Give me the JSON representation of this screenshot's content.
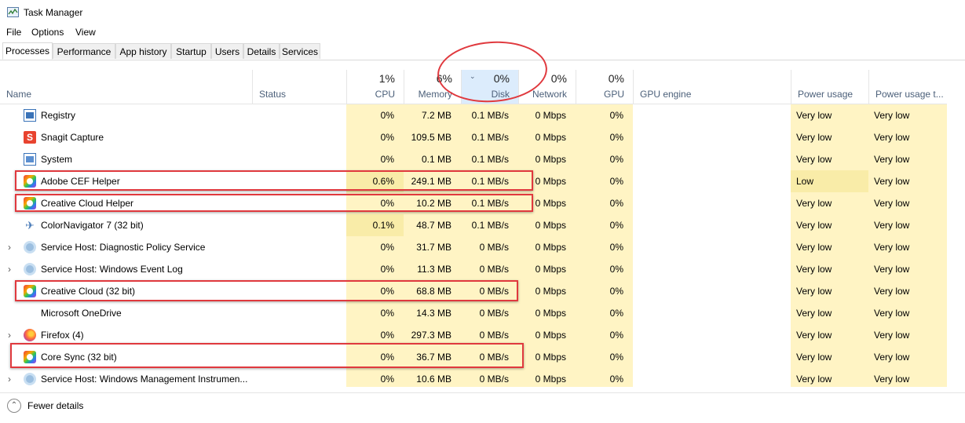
{
  "window": {
    "title": "Task Manager"
  },
  "menu": [
    "File",
    "Options",
    "View"
  ],
  "tabs": [
    "Processes",
    "Performance",
    "App history",
    "Startup",
    "Users",
    "Details",
    "Services"
  ],
  "active_tab": "Processes",
  "columns": {
    "name": "Name",
    "status": "Status",
    "cpu": {
      "pct": "1%",
      "label": "CPU"
    },
    "memory": {
      "pct": "6%",
      "label": "Memory"
    },
    "disk": {
      "pct": "0%",
      "label": "Disk"
    },
    "network": {
      "pct": "0%",
      "label": "Network"
    },
    "gpu": {
      "pct": "0%",
      "label": "GPU"
    },
    "gpu_engine": "GPU engine",
    "power": "Power usage",
    "power_trend": "Power usage t..."
  },
  "rows": [
    {
      "name": "Registry",
      "icon": "registry-icon",
      "expand": false,
      "cpu": "0%",
      "memory": "7.2 MB",
      "disk": "0.1 MB/s",
      "network": "0 Mbps",
      "gpu": "0%",
      "power": "Very low",
      "power_trend": "Very low"
    },
    {
      "name": "Snagit Capture",
      "icon": "snagit-icon",
      "expand": false,
      "cpu": "0%",
      "memory": "109.5 MB",
      "disk": "0.1 MB/s",
      "network": "0 Mbps",
      "gpu": "0%",
      "power": "Very low",
      "power_trend": "Very low"
    },
    {
      "name": "System",
      "icon": "system-icon",
      "expand": false,
      "cpu": "0%",
      "memory": "0.1 MB",
      "disk": "0.1 MB/s",
      "network": "0 Mbps",
      "gpu": "0%",
      "power": "Very low",
      "power_trend": "Very low"
    },
    {
      "name": "Adobe CEF Helper",
      "icon": "creative-cloud-icon",
      "expand": false,
      "cpu": "0.6%",
      "memory": "249.1 MB",
      "disk": "0.1 MB/s",
      "network": "0 Mbps",
      "gpu": "0%",
      "power": "Low",
      "power_trend": "Very low"
    },
    {
      "name": "Creative Cloud Helper",
      "icon": "creative-cloud-icon",
      "expand": false,
      "cpu": "0%",
      "memory": "10.2 MB",
      "disk": "0.1 MB/s",
      "network": "0 Mbps",
      "gpu": "0%",
      "power": "Very low",
      "power_trend": "Very low"
    },
    {
      "name": "ColorNavigator 7 (32 bit)",
      "icon": "colornavigator-icon",
      "expand": false,
      "cpu": "0.1%",
      "memory": "48.7 MB",
      "disk": "0.1 MB/s",
      "network": "0 Mbps",
      "gpu": "0%",
      "power": "Very low",
      "power_trend": "Very low"
    },
    {
      "name": "Service Host: Diagnostic Policy Service",
      "icon": "service-gear-icon",
      "expand": true,
      "cpu": "0%",
      "memory": "31.7 MB",
      "disk": "0 MB/s",
      "network": "0 Mbps",
      "gpu": "0%",
      "power": "Very low",
      "power_trend": "Very low"
    },
    {
      "name": "Service Host: Windows Event Log",
      "icon": "service-gear-icon",
      "expand": true,
      "cpu": "0%",
      "memory": "11.3 MB",
      "disk": "0 MB/s",
      "network": "0 Mbps",
      "gpu": "0%",
      "power": "Very low",
      "power_trend": "Very low"
    },
    {
      "name": "Creative Cloud (32 bit)",
      "icon": "creative-cloud-icon",
      "expand": false,
      "cpu": "0%",
      "memory": "68.8 MB",
      "disk": "0 MB/s",
      "network": "0 Mbps",
      "gpu": "0%",
      "power": "Very low",
      "power_trend": "Very low"
    },
    {
      "name": "Microsoft OneDrive",
      "icon": "",
      "expand": false,
      "cpu": "0%",
      "memory": "14.3 MB",
      "disk": "0 MB/s",
      "network": "0 Mbps",
      "gpu": "0%",
      "power": "Very low",
      "power_trend": "Very low"
    },
    {
      "name": "Firefox (4)",
      "icon": "firefox-icon",
      "expand": true,
      "cpu": "0%",
      "memory": "297.3 MB",
      "disk": "0 MB/s",
      "network": "0 Mbps",
      "gpu": "0%",
      "power": "Very low",
      "power_trend": "Very low"
    },
    {
      "name": "Core Sync (32 bit)",
      "icon": "creative-cloud-icon",
      "expand": false,
      "cpu": "0%",
      "memory": "36.7 MB",
      "disk": "0 MB/s",
      "network": "0 Mbps",
      "gpu": "0%",
      "power": "Very low",
      "power_trend": "Very low"
    },
    {
      "name": "Service Host: Windows Management Instrumen...",
      "icon": "service-gear-icon",
      "expand": true,
      "cpu": "0%",
      "memory": "10.6 MB",
      "disk": "0 MB/s",
      "network": "0 Mbps",
      "gpu": "0%",
      "power": "Very low",
      "power_trend": "Very low"
    }
  ],
  "footer": {
    "fewer_details": "Fewer details"
  },
  "colors": {
    "heat": "#fff4c4",
    "heat_strong": "#f9eca8",
    "sorted_header": "#dcecfc",
    "annotation": "#e0393e"
  }
}
